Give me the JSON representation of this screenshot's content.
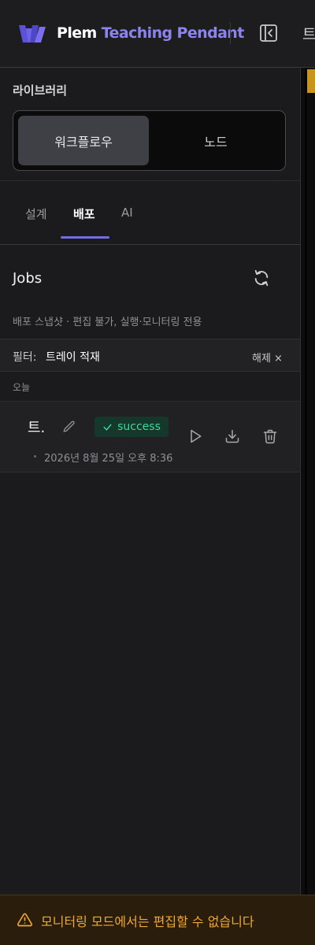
{
  "header": {
    "brand_primary": "Plem",
    "brand_secondary": "Teaching Pendant",
    "cut_text": "트",
    "logo_icon": "plem-logo-icon",
    "collapse_icon": "sidebar-collapse-icon"
  },
  "library": {
    "title": "라이브러리",
    "segments": [
      {
        "label": "워크플로우",
        "active": true
      },
      {
        "label": "노드",
        "active": false
      }
    ]
  },
  "tabs": [
    {
      "label": "설계",
      "active": false
    },
    {
      "label": "배포",
      "active": true
    },
    {
      "label": "AI",
      "active": false
    }
  ],
  "jobs": {
    "title": "Jobs",
    "refresh_icon": "refresh-icon",
    "subtitle": "배포 스냅샷 · 편집 불가, 실행·모니터링 전용",
    "filter": {
      "label": "필터:",
      "value": "트레이 적재",
      "clear_label": "해제 ×"
    },
    "groups": [
      {
        "label": "오늘",
        "items": [
          {
            "name": "트.",
            "status": "success",
            "status_icon": "check-icon",
            "timestamp": "2026년 8월 25일 오후 8:36",
            "actions": [
              "play-icon",
              "download-icon",
              "trash-icon"
            ]
          }
        ]
      }
    ]
  },
  "warning": {
    "icon": "warning-icon",
    "text": "모니터링 모드에서는 편집할 수 없습니다"
  },
  "colors": {
    "accent": "#6f6ee3",
    "brand_secondary": "#8b83f0",
    "success_bg": "#15372c",
    "success_text": "#41d79a",
    "warning_text": "#f0a932",
    "warning_bg": "#2a1d0b"
  }
}
